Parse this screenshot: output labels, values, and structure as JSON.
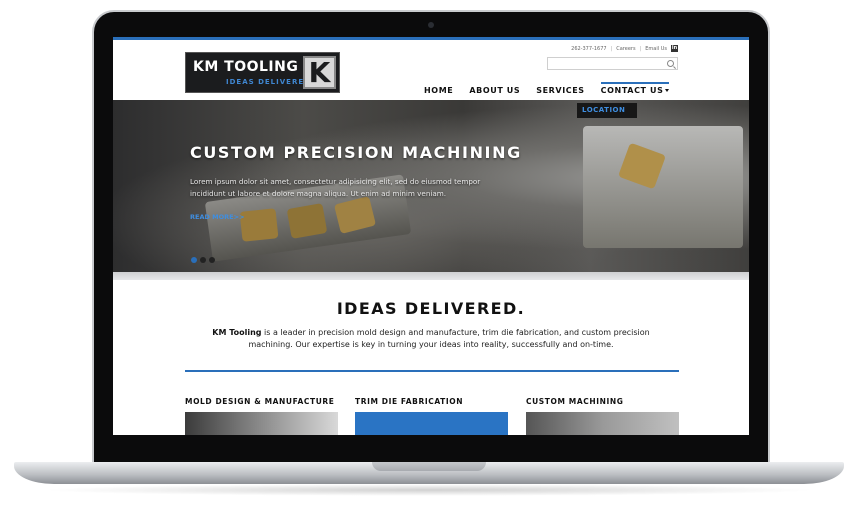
{
  "site": {
    "logo": {
      "name": "KM TOOLING",
      "tagline": "IDEAS DELIVERED",
      "mark": "K"
    },
    "utility": {
      "phone": "262-377-1677",
      "careers": "Careers",
      "email": "Email Us",
      "social": "in"
    },
    "search": {
      "placeholder": ""
    },
    "nav": [
      {
        "label": "HOME"
      },
      {
        "label": "ABOUT US"
      },
      {
        "label": "SERVICES"
      },
      {
        "label": "CONTACT US"
      }
    ],
    "dropdown": {
      "item": "LOCATION"
    },
    "hero": {
      "title": "CUSTOM PRECISION MACHINING",
      "body": "Lorem ipsum dolor sit amet, consectetur adipisicing elit, sed do eiusmod tempor incididunt ut labore et dolore magna aliqua. Ut enim ad minim veniam.",
      "link": "READ MORE>>"
    },
    "headline": "IDEAS DELIVERED.",
    "intro": {
      "brand": "KM Tooling",
      "text": " is a leader in precision mold design and manufacture, trim die fabrication, and custom precision machining. Our expertise is key in turning your ideas into reality, successfully and on-time."
    },
    "columns": [
      {
        "title": "MOLD DESIGN & MANUFACTURE"
      },
      {
        "title": "TRIM DIE FABRICATION"
      },
      {
        "title": "CUSTOM MACHINING"
      }
    ],
    "colors": {
      "accent": "#2a6fba",
      "dark": "#1b1c1e"
    }
  }
}
